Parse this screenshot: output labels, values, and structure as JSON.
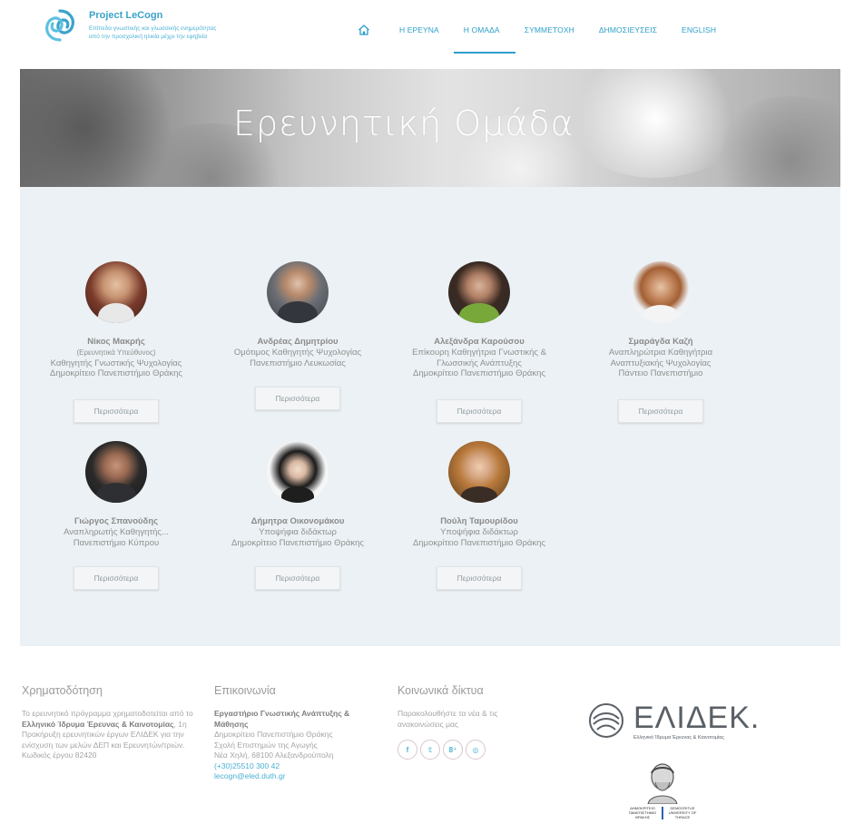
{
  "header": {
    "brand_title": "Project LeCogn",
    "brand_subtitle_1": "Επίπεδα γνωστικής και γλωσσικής ενημερότητας",
    "brand_subtitle_2": "από την προσχολική ηλικία μέχρι την εφηβεία",
    "nav": {
      "home_icon": "home-icon",
      "items": [
        "Η ΕΡΕΥΝΑ",
        "Η ΟΜΑΔΑ",
        "ΣΥΜΜΕΤΟΧΗ",
        "ΔΗΜΟΣΙΕΥΣΕΙΣ",
        "ENGLISH"
      ],
      "active": "Η ΟΜΑΔΑ"
    }
  },
  "hero": {
    "title": "Ερευνητική Ομάδα"
  },
  "team": {
    "more_label": "Περισσότερα",
    "members": [
      {
        "name": "Νίκος Μακρής",
        "lines": [
          "(Ερευνητικά Υπεύθυνος)",
          "Καθηγητής Γνωστικής Ψυχολογίας",
          "Δημοκρίτειο Πανεπιστήμιο Θράκης"
        ]
      },
      {
        "name": "Ανδρέας Δημητρίου",
        "lines": [
          "Ομότιμος Καθηγητής Ψυχολογίας",
          "Πανεπιστήμιο Λευκωσίας"
        ]
      },
      {
        "name": "Αλεξάνδρα Καρούσου",
        "lines": [
          "Επίκουρη Καθηγήτρια Γνωστικής &",
          "Γλωσσικής Ανάπτυξης",
          "Δημοκρίτειο Πανεπιστήμιο Θράκης"
        ]
      },
      {
        "name": "Σμαράγδα Καζή",
        "lines": [
          "Αναπληρώτρια Καθηγήτρια",
          "Αναπτυξιακής Ψυχολογίας",
          "Πάντειο Πανεπιστήμιο"
        ]
      },
      {
        "name": "Γιώργος Σπανούδης",
        "lines": [
          "Αναπληρωτής Καθηγητής...",
          "Πανεπιστήμιο Κύπρου"
        ]
      },
      {
        "name": "Δήμητρα Οικονομάκου",
        "lines": [
          "Υποψήφια διδάκτωρ",
          "Δημοκρίτειο Πανεπιστήμιο Θράκης"
        ]
      },
      {
        "name": "Πούλη Ταμουρίδου",
        "lines": [
          "Υποψήφια διδάκτωρ",
          "Δημοκρίτειο Πανεπιστήμιο Θράκης"
        ]
      }
    ]
  },
  "footer": {
    "funding": {
      "heading": "Χρηματοδότηση",
      "text_1": "Το ερευνητικό πρόγραμμα χρηματοδοτείται από το ",
      "text_bold": "Ελληνικό Ίδρυμα Έρευνας & Καινοτομίας",
      "text_2": ", 1η Προκήρυξη ερευνητικών έργων ΕΛΙΔΕΚ για την ενίσχυση των μελών ΔΕΠ και Ερευνητών/τριών.",
      "code": "Κωδικός έργου 82420"
    },
    "contact": {
      "heading": "Επικοινωνία",
      "lab": "Εργαστήριο Γνωστικής Ανάπτυξης & Μάθησης",
      "line_1": "Δημοκρίτειο Πανεπιστήμιο Θράκης",
      "line_2": "Σχολή Επιστημών της Αγωγής",
      "line_3": "Νέα Χηλή, 68100 Αλεξανδρούπολη",
      "phone": "(+30)25510 300 42",
      "email": "lecogn@eled.duth.gr"
    },
    "social": {
      "heading": "Κοινωνικά δίκτυα",
      "text": "Παρακολουθήστε τα νέα & τις ανακοινώσεις μας",
      "icons": [
        "facebook-icon",
        "twitter-icon",
        "google-plus-icon",
        "pinterest-icon"
      ],
      "glyphs": [
        "f",
        "𝕥",
        "8⁺",
        "◎"
      ]
    },
    "elidek": {
      "name": "ΕΛΙΔΕΚ.",
      "subtitle": "Ελληνικό Ίδρυμα Έρευνας & Καινοτομίας"
    },
    "duth": {
      "left": "ΔΗΜΟΚΡΙΤΕΙΟ ΠΑΝΕΠΙΣΤΗΜΙΟ ΘΡΑΚΗΣ",
      "right": "DEMOCRITUS UNIVERSITY OF THRACE"
    }
  },
  "colors": {
    "accent": "#2d9fc8",
    "team_bg": "#ebf1f4"
  }
}
